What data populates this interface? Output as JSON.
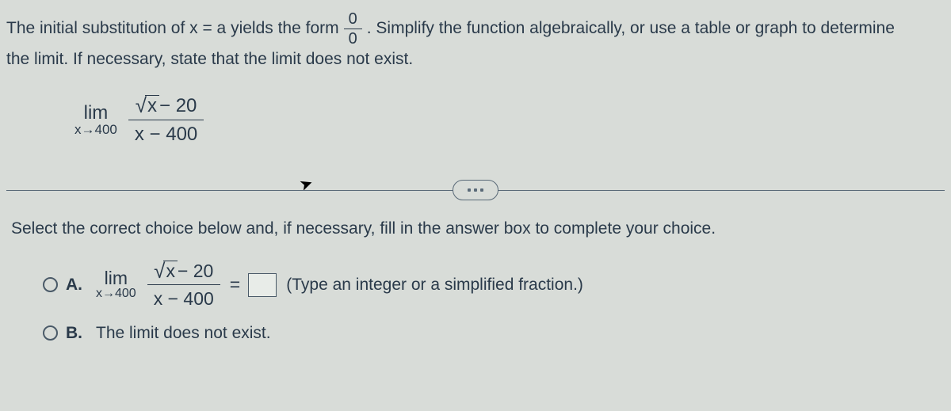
{
  "intro": {
    "part1": "The initial substitution of x = a yields the form",
    "frac_num": "0",
    "frac_den": "0",
    "part2": ". Simplify the function algebraically, or use a table or graph to determine",
    "line2": "the limit. If necessary, state that the limit does not exist."
  },
  "limit": {
    "lim": "lim",
    "sub": "x→400",
    "num_radicand": "x",
    "num_rest": " − 20",
    "den": "x − 400"
  },
  "prompt2": "Select the correct choice below and, if necessary, fill in the answer box to complete your choice.",
  "choiceA": {
    "label": "A.",
    "lim": "lim",
    "sub": "x→400",
    "num_radicand": "x",
    "num_rest": " − 20",
    "den": "x − 400",
    "eq": "=",
    "hint": "(Type an integer or a simplified fraction.)"
  },
  "choiceB": {
    "label": "B.",
    "text": "The limit does not exist."
  }
}
